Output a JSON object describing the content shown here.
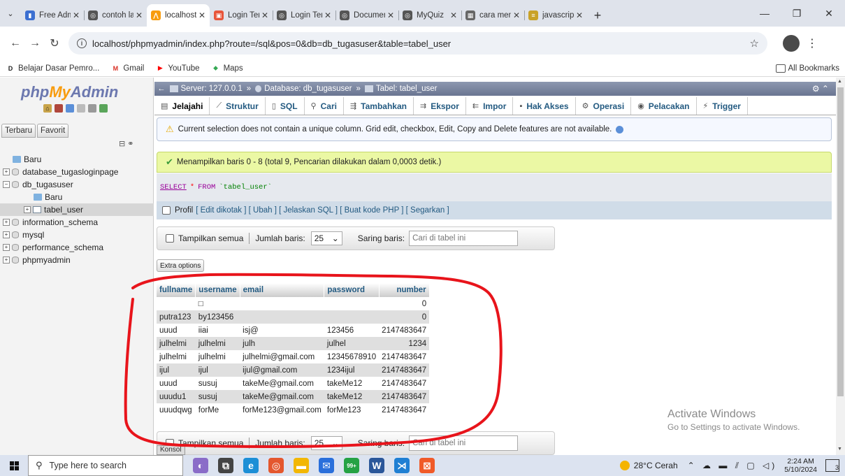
{
  "browser": {
    "tabs": [
      {
        "label": "Free Adm",
        "color": "#3b6fd1",
        "glyph": "▮"
      },
      {
        "label": "contoh la",
        "color": "#555555",
        "glyph": "◎"
      },
      {
        "label": "localhost",
        "color": "#f89c0e",
        "glyph": "⋀",
        "active": true
      },
      {
        "label": "Login Ten",
        "color": "#e8553a",
        "glyph": "▣"
      },
      {
        "label": "Login Ten",
        "color": "#555555",
        "glyph": "◎"
      },
      {
        "label": "Documen",
        "color": "#555555",
        "glyph": "◎"
      },
      {
        "label": "MyQuiz",
        "color": "#555555",
        "glyph": "◎"
      },
      {
        "label": "cara mem",
        "color": "#666666",
        "glyph": "▦"
      },
      {
        "label": "javascript",
        "color": "#c9a227",
        "glyph": "≡"
      }
    ],
    "url": "localhost/phpmyadmin/index.php?route=/sql&pos=0&db=db_tugasuser&table=tabel_user",
    "bookmarks": [
      {
        "label": "Belajar Dasar Pemro...",
        "color": "#222222",
        "glyph": "D"
      },
      {
        "label": "Gmail",
        "color": "#d93025",
        "glyph": "M"
      },
      {
        "label": "YouTube",
        "color": "#ff0000",
        "glyph": "▶"
      },
      {
        "label": "Maps",
        "color": "#34a853",
        "glyph": "⬥"
      }
    ],
    "all_bookmarks": "All Bookmarks"
  },
  "sidebar": {
    "logo": {
      "php": "php",
      "my": "My",
      "admin": "Admin"
    },
    "tabs": [
      "Terbaru",
      "Favorit"
    ],
    "tree": [
      {
        "label": "Baru",
        "type": "new",
        "indent": 0
      },
      {
        "label": "database_tugasloginpage",
        "type": "db",
        "indent": 0
      },
      {
        "label": "db_tugasuser",
        "type": "db-open",
        "indent": 0
      },
      {
        "label": "Baru",
        "type": "new",
        "indent": 1
      },
      {
        "label": "tabel_user",
        "type": "table",
        "indent": 1,
        "selected": true
      },
      {
        "label": "information_schema",
        "type": "db",
        "indent": 0
      },
      {
        "label": "mysql",
        "type": "db",
        "indent": 0
      },
      {
        "label": "performance_schema",
        "type": "db",
        "indent": 0
      },
      {
        "label": "phpmyadmin",
        "type": "db",
        "indent": 0
      }
    ]
  },
  "breadcrumb": {
    "server": "Server: 127.0.0.1",
    "database": "Database: db_tugasuser",
    "table": "Tabel: tabel_user"
  },
  "menu_tabs": [
    {
      "label": "Jelajahi",
      "icon": "▤",
      "active": true
    },
    {
      "label": "Struktur",
      "icon": "⟋"
    },
    {
      "label": "SQL",
      "icon": "▯"
    },
    {
      "label": "Cari",
      "icon": "⚲"
    },
    {
      "label": "Tambahkan",
      "icon": "⇶"
    },
    {
      "label": "Ekspor",
      "icon": "⇉"
    },
    {
      "label": "Impor",
      "icon": "⇇"
    },
    {
      "label": "Hak Akses",
      "icon": "▪"
    },
    {
      "label": "Operasi",
      "icon": "⚙"
    },
    {
      "label": "Pelacakan",
      "icon": "◉"
    },
    {
      "label": "Trigger",
      "icon": "⚡"
    }
  ],
  "notice": "Current selection does not contain a unique column. Grid edit, checkbox, Edit, Copy and Delete features are not available.",
  "success": "Menampilkan baris 0 - 8 (total 9, Pencarian dilakukan dalam 0,0003 detik.)",
  "sql": {
    "select": "SELECT",
    "star": "*",
    "from": "FROM",
    "table": "`tabel_user`"
  },
  "profil": {
    "label": "Profil",
    "links": "[ Edit dikotak ] [ Ubah ] [ Jelaskan SQL ] [ Buat kode PHP ] [ Segarkan ]"
  },
  "controls": {
    "show_all": "Tampilkan semua",
    "rows_label": "Jumlah baris:",
    "rows_value": "25",
    "filter_label": "Saring baris:",
    "filter_placeholder": "Cari di tabel ini"
  },
  "extra_options": "Extra options",
  "table": {
    "columns": [
      {
        "label": "fullname",
        "num": false
      },
      {
        "label": "username",
        "num": false
      },
      {
        "label": "email",
        "num": false
      },
      {
        "label": "password",
        "num": false
      },
      {
        "label": "number",
        "num": true
      }
    ],
    "rows": [
      [
        "",
        "□",
        "",
        "",
        "0"
      ],
      [
        "putra123",
        "by123456",
        "",
        "",
        "0"
      ],
      [
        "uuud",
        "iiai",
        "isj@",
        "123456",
        "2147483647"
      ],
      [
        "julhelmi",
        "julhelmi",
        "julh",
        "julhel",
        "1234"
      ],
      [
        "julhelmi",
        "julhelmi",
        "julhelmi@gmail.com",
        "12345678910",
        "2147483647"
      ],
      [
        "ijul",
        "ijul",
        "ijul@gmail.com",
        "1234ijul",
        "2147483647"
      ],
      [
        "uuud",
        "susuj",
        "takeMe@gmail.com",
        "takeMe12",
        "2147483647"
      ],
      [
        "uuudu1",
        "susuj",
        "takeMe@gmail.com",
        "takeMe12",
        "2147483647"
      ],
      [
        "uuudqwg",
        "forMe",
        "forMe123@gmail.com",
        "forMe123",
        "2147483647"
      ]
    ]
  },
  "konsol": "Konsol",
  "activate": {
    "title": "Activate Windows",
    "subtitle": "Go to Settings to activate Windows."
  },
  "taskbar": {
    "search": "Type here to search",
    "weather": "28°C Cerah",
    "time": "2:24 AM",
    "date": "5/10/2024",
    "notifications": "3",
    "apps": [
      {
        "name": "widget",
        "color": "#8a6cc8",
        "glyph": "◐"
      },
      {
        "name": "taskview",
        "color": "#444444",
        "glyph": "⧉"
      },
      {
        "name": "edge",
        "color": "#1d8fd6",
        "glyph": "e"
      },
      {
        "name": "chrome",
        "color": "#e4572e",
        "glyph": "◎"
      },
      {
        "name": "explorer",
        "color": "#f2b705",
        "glyph": "▬"
      },
      {
        "name": "mail",
        "color": "#2a6fdb",
        "glyph": "✉"
      },
      {
        "name": "whatsapp",
        "color": "#25a244",
        "glyph": "99+"
      },
      {
        "name": "word",
        "color": "#2b579a",
        "glyph": "W"
      },
      {
        "name": "vscode",
        "color": "#1f7fd3",
        "glyph": "⋊"
      },
      {
        "name": "xampp",
        "color": "#f05a28",
        "glyph": "⊠"
      }
    ]
  }
}
